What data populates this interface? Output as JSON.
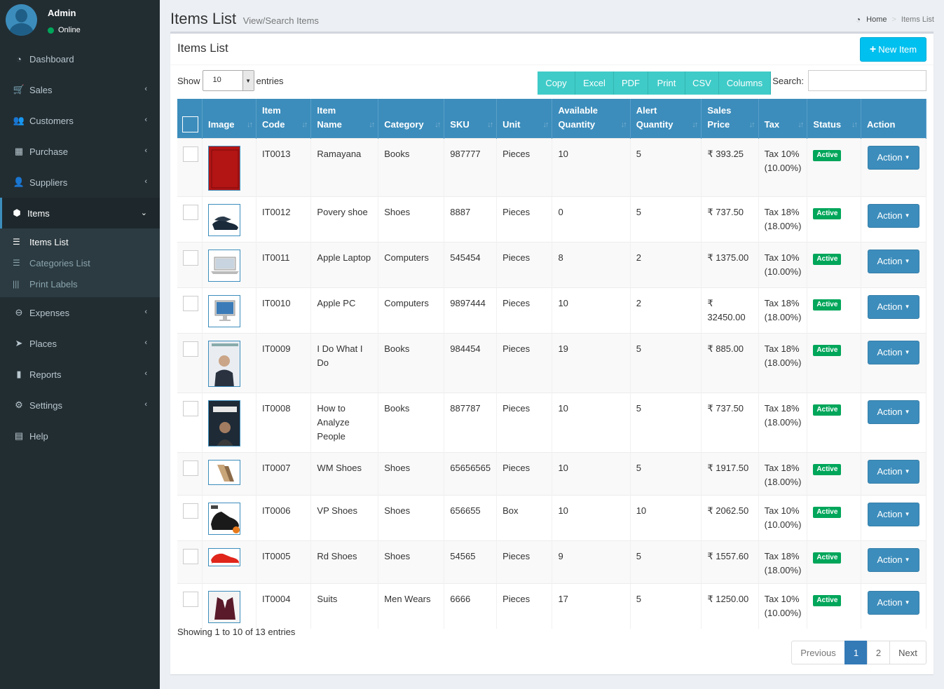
{
  "user": {
    "name": "Admin",
    "status": "Online"
  },
  "sidebar": {
    "items": [
      {
        "label": "Dashboard",
        "icon": "dashboard-icon",
        "glyph": "◔",
        "chevron": ""
      },
      {
        "label": "Sales",
        "icon": "shopping-cart-icon",
        "glyph": "🛒",
        "chevron": "‹"
      },
      {
        "label": "Customers",
        "icon": "users-icon",
        "glyph": "👥",
        "chevron": "‹"
      },
      {
        "label": "Purchase",
        "icon": "grid-icon",
        "glyph": "▦",
        "chevron": "‹"
      },
      {
        "label": "Suppliers",
        "icon": "user-plus-icon",
        "glyph": "👤",
        "chevron": "‹"
      },
      {
        "label": "Items",
        "icon": "cubes-icon",
        "glyph": "⬢",
        "chevron": "⌄"
      },
      {
        "label": "Expenses",
        "icon": "minus-circle-icon",
        "glyph": "⊖",
        "chevron": "‹"
      },
      {
        "label": "Places",
        "icon": "paper-plane-icon",
        "glyph": "➤",
        "chevron": "‹"
      },
      {
        "label": "Reports",
        "icon": "bar-chart-icon",
        "glyph": "▮",
        "chevron": "‹"
      },
      {
        "label": "Settings",
        "icon": "cogs-icon",
        "glyph": "⚙",
        "chevron": "‹"
      },
      {
        "label": "Help",
        "icon": "book-icon",
        "glyph": "▤",
        "chevron": ""
      }
    ],
    "submenu": [
      {
        "label": "Items List",
        "glyph": "☰"
      },
      {
        "label": "Categories List",
        "glyph": "☰"
      },
      {
        "label": "Print Labels",
        "glyph": "|||"
      }
    ]
  },
  "header": {
    "title": "Items List",
    "subtitle": "View/Search Items",
    "breadcrumb_home": "Home",
    "breadcrumb_current": "Items List"
  },
  "box": {
    "title": "Items List",
    "new_button": "New Item"
  },
  "controls": {
    "show_label": "Show",
    "entries_value": "10",
    "entries_label": "entries",
    "search_label": "Search:",
    "buttons": [
      "Copy",
      "Excel",
      "PDF",
      "Print",
      "CSV",
      "Columns"
    ]
  },
  "table": {
    "columns": [
      {
        "l1": "",
        "l2": "Image"
      },
      {
        "l1": "Item",
        "l2": "Code"
      },
      {
        "l1": "Item",
        "l2": "Name"
      },
      {
        "l1": "",
        "l2": "Category"
      },
      {
        "l1": "",
        "l2": "SKU"
      },
      {
        "l1": "",
        "l2": "Unit"
      },
      {
        "l1": "Available",
        "l2": "Quantity"
      },
      {
        "l1": "Alert",
        "l2": "Quantity"
      },
      {
        "l1": "Sales",
        "l2": "Price"
      },
      {
        "l1": "",
        "l2": "Tax"
      },
      {
        "l1": "",
        "l2": "Status"
      },
      {
        "l1": "",
        "l2": "Action"
      }
    ],
    "rows": [
      {
        "code": "IT0013",
        "name": "Ramayana",
        "category": "Books",
        "sku": "987777",
        "unit": "Pieces",
        "available": "10",
        "alert": "5",
        "price": "₹ 393.25",
        "tax": "Tax 10%",
        "tax_pct": "(10.00%)",
        "status": "Active",
        "action": "Action",
        "image": "book-red"
      },
      {
        "code": "IT0012",
        "name": "Povery shoe",
        "category": "Shoes",
        "sku": "8887",
        "unit": "Pieces",
        "available": "0",
        "alert": "5",
        "price": "₹ 737.50",
        "tax": "Tax 18%",
        "tax_pct": "(18.00%)",
        "status": "Active",
        "action": "Action",
        "image": "formal-shoe"
      },
      {
        "code": "IT0011",
        "name": "Apple Laptop",
        "category": "Computers",
        "sku": "545454",
        "unit": "Pieces",
        "available": "8",
        "alert": "2",
        "price": "₹ 1375.00",
        "tax": "Tax 10%",
        "tax_pct": "(10.00%)",
        "status": "Active",
        "action": "Action",
        "image": "laptop"
      },
      {
        "code": "IT0010",
        "name": "Apple PC",
        "category": "Computers",
        "sku": "9897444",
        "unit": "Pieces",
        "available": "10",
        "alert": "2",
        "price": "₹ 32450.00",
        "tax": "Tax 18%",
        "tax_pct": "(18.00%)",
        "status": "Active",
        "action": "Action",
        "image": "desktop"
      },
      {
        "code": "IT0009",
        "name": "I Do What I Do",
        "category": "Books",
        "sku": "984454",
        "unit": "Pieces",
        "available": "19",
        "alert": "5",
        "price": "₹ 885.00",
        "tax": "Tax 18%",
        "tax_pct": "(18.00%)",
        "status": "Active",
        "action": "Action",
        "image": "book-cover-man"
      },
      {
        "code": "IT0008",
        "name": "How to Analyze People",
        "category": "Books",
        "sku": "887787",
        "unit": "Pieces",
        "available": "10",
        "alert": "5",
        "price": "₹ 737.50",
        "tax": "Tax 18%",
        "tax_pct": "(18.00%)",
        "status": "Active",
        "action": "Action",
        "image": "book-people"
      },
      {
        "code": "IT0007",
        "name": "WM Shoes",
        "category": "Shoes",
        "sku": "65656565",
        "unit": "Pieces",
        "available": "10",
        "alert": "5",
        "price": "₹ 1917.50",
        "tax": "Tax 18%",
        "tax_pct": "(18.00%)",
        "status": "Active",
        "action": "Action",
        "image": "heels"
      },
      {
        "code": "IT0006",
        "name": "VP Shoes",
        "category": "Shoes",
        "sku": "656655",
        "unit": "Box",
        "available": "10",
        "alert": "10",
        "price": "₹ 2062.50",
        "tax": "Tax 10%",
        "tax_pct": "(10.00%)",
        "status": "Active",
        "action": "Action",
        "image": "sneaker-black"
      },
      {
        "code": "IT0005",
        "name": "Rd Shoes",
        "category": "Shoes",
        "sku": "54565",
        "unit": "Pieces",
        "available": "9",
        "alert": "5",
        "price": "₹ 1557.60",
        "tax": "Tax 18%",
        "tax_pct": "(18.00%)",
        "status": "Active",
        "action": "Action",
        "image": "sneaker-red"
      },
      {
        "code": "IT0004",
        "name": "Suits",
        "category": "Men Wears",
        "sku": "6666",
        "unit": "Pieces",
        "available": "17",
        "alert": "5",
        "price": "₹ 1250.00",
        "tax": "Tax 10%",
        "tax_pct": "(10.00%)",
        "status": "Active",
        "action": "Action",
        "image": "suit"
      }
    ]
  },
  "footer": {
    "info": "Showing 1 to 10 of 13 entries",
    "previous": "Previous",
    "pages": [
      "1",
      "2"
    ],
    "next": "Next"
  },
  "colors": {
    "sidebar": "#222d32",
    "primary": "#3c8dbc",
    "info": "#00c0ef",
    "success": "#00a65a",
    "dt_button": "#3fcbc8"
  }
}
